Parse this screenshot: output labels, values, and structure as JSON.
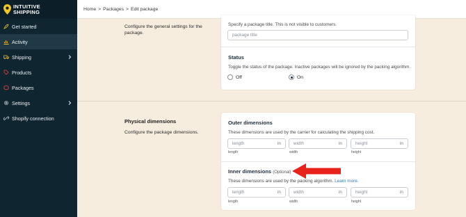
{
  "brand": {
    "line1": "INTUITIVE",
    "line2": "SHIPPING",
    "pin_color": "#f3c623"
  },
  "sidebar": {
    "items": [
      {
        "label": "Get started",
        "icon": "rocket-icon"
      },
      {
        "label": "Activity",
        "icon": "chart-icon"
      },
      {
        "label": "Shipping",
        "icon": "truck-icon"
      },
      {
        "label": "Products",
        "icon": "tag-icon"
      },
      {
        "label": "Packages",
        "icon": "box-icon"
      },
      {
        "label": "Settings",
        "icon": "gear-icon"
      },
      {
        "label": "Shopify connection",
        "icon": "link-icon"
      }
    ]
  },
  "breadcrumb": {
    "home": "Home",
    "sep1": ">",
    "packages": "Packages",
    "sep2": ">",
    "current": "Edit package"
  },
  "general": {
    "description": "Configure the general settings for the package.",
    "title_hint": "Specify a package title. This is not visible to customers.",
    "title_placeholder": "package title",
    "status_heading": "Status",
    "status_hint": "Toggle the status of the package. Inactive packages will be ignored by the packing algorithm.",
    "status_off": "Off",
    "status_on": "On",
    "status_selected": "On"
  },
  "physical": {
    "title": "Physical dimensions",
    "description": "Configure the package dimensions.",
    "outer": {
      "heading": "Outer dimensions",
      "hint": "These dimensions are used by the carrier for calculating the shipping cost.",
      "fields": [
        {
          "placeholder": "length",
          "unit": "in",
          "label": "length"
        },
        {
          "placeholder": "width",
          "unit": "in",
          "label": "width"
        },
        {
          "placeholder": "height",
          "unit": "in",
          "label": "height"
        }
      ]
    },
    "inner": {
      "heading": "Inner dimensions",
      "optional": "(Optional)",
      "hint": "These dimensions are used by the packing algorithm.",
      "learn_more": "Learn more.",
      "fields": [
        {
          "placeholder": "length",
          "unit": "in",
          "label": "length"
        },
        {
          "placeholder": "width",
          "unit": "in",
          "label": "width"
        },
        {
          "placeholder": "height",
          "unit": "in",
          "label": "height"
        }
      ]
    }
  },
  "colors": {
    "sidebar_bg": "#0f2530",
    "page_bg": "#f6edde",
    "arrow": "#e8231b",
    "link": "#2a7bbd"
  }
}
